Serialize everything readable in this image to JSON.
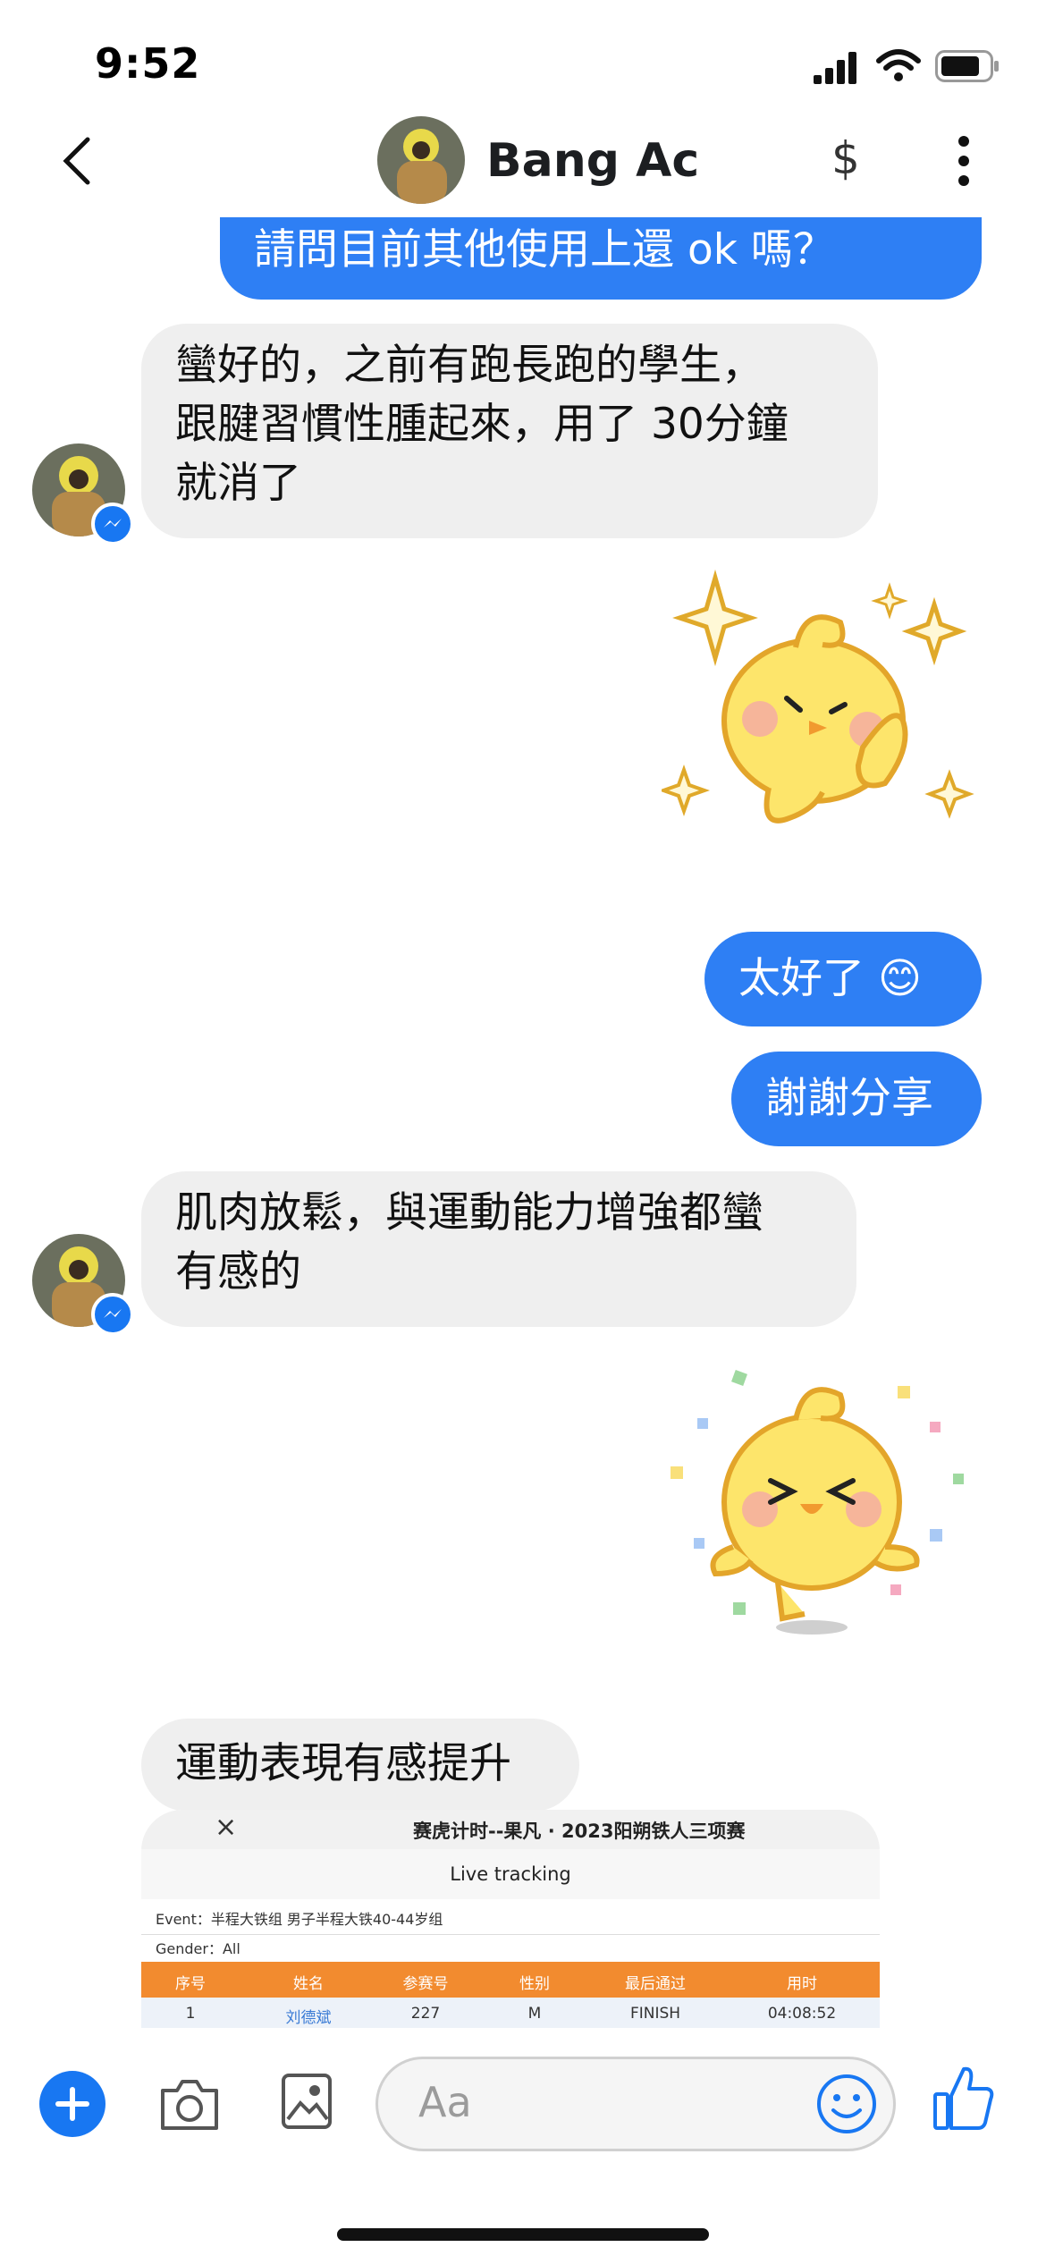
{
  "status_bar": {
    "time": "9:52"
  },
  "header": {
    "contact_name": "Bang Ac",
    "dollar_label": "$"
  },
  "colors": {
    "accent": "#2e7ff4",
    "incoming_bubble": "#efefef",
    "messenger_blue": "#1877f2"
  },
  "messages": {
    "m1": "請問目前其他使用上還 ok 嗎？",
    "m2": "蠻好的，之前有跑長跑的學生，\n跟腱習慣性腫起來，用了 30分鐘\n就消了",
    "m3": "太好了 😊",
    "m4": "謝謝分享",
    "m5": "肌肉放鬆，與運動能力增強都蠻\n有感的",
    "m6": "運動表現有感提升"
  },
  "shared_screenshot": {
    "close_icon": "×",
    "title": "赛虎计时--果凡 · 2023阳朔铁人三项赛",
    "subtitle": "Live tracking",
    "event_line": "Event：半程大铁组 男子半程大铁40-44岁组",
    "gender_line": "Gender：All",
    "columns": [
      "序号",
      "姓名",
      "参赛号",
      "性别",
      "最后通过",
      "用时"
    ],
    "row": [
      "1",
      "刘德斌",
      "227",
      "M",
      "FINISH",
      "04:08:52"
    ]
  },
  "composer": {
    "placeholder": "Aa"
  },
  "icons": {
    "back": "chevron-left-icon",
    "more": "more-vertical-icon",
    "plus": "plus-icon",
    "camera": "camera-icon",
    "gallery": "image-icon",
    "emoji": "smiley-icon",
    "like": "thumbs-up-icon"
  }
}
